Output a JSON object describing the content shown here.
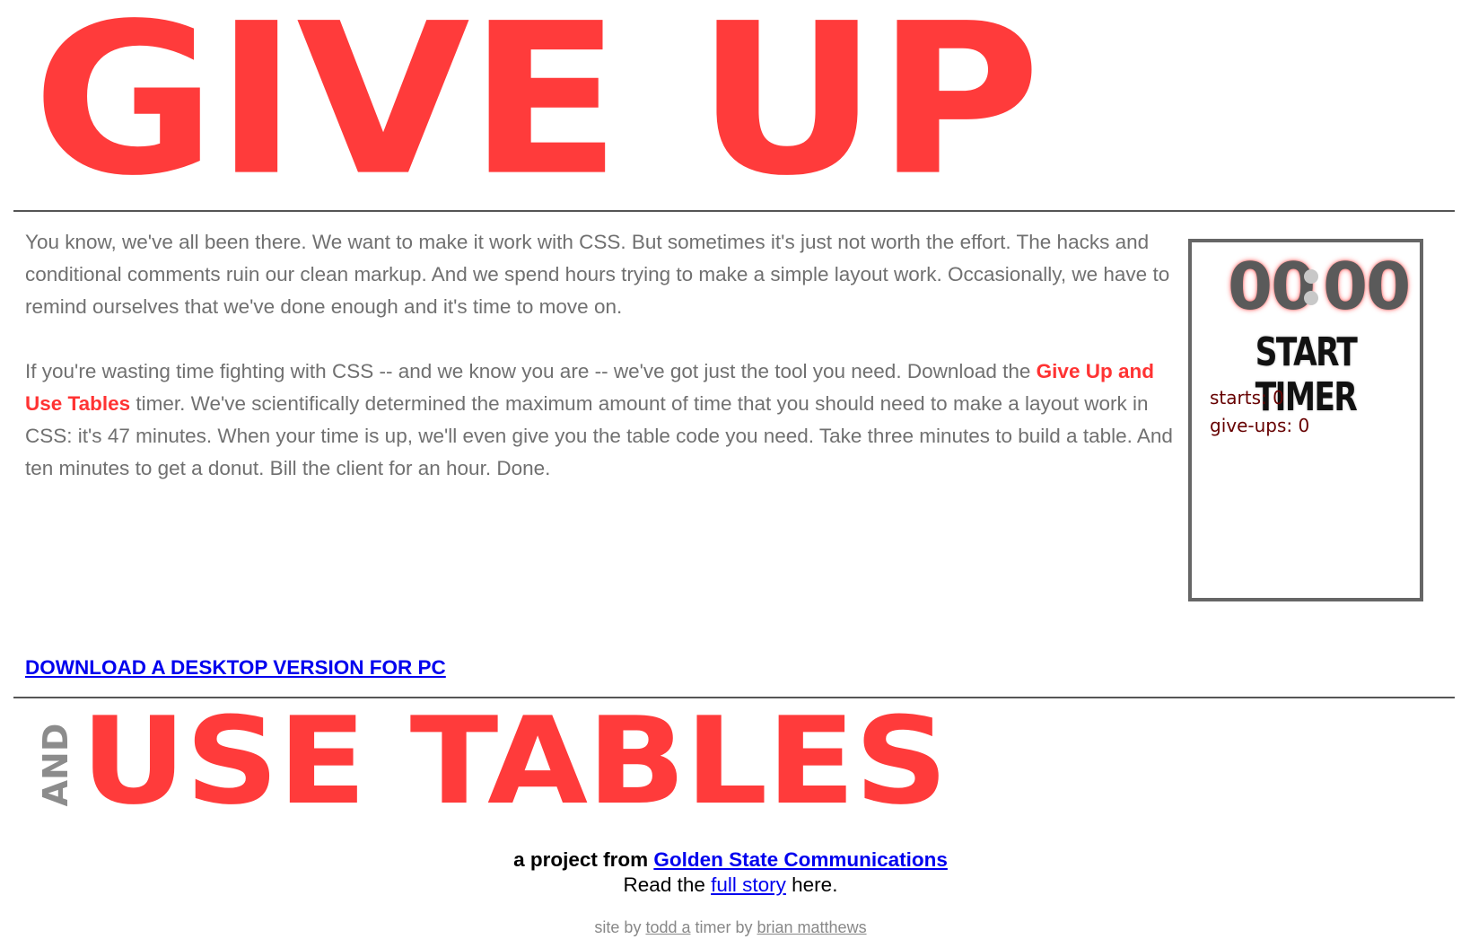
{
  "header": {
    "title": "GIVE UP"
  },
  "intro": {
    "paragraph1": "You know, we've all been there. We want to make it work with CSS. But sometimes it's just not worth the effort. The hacks and conditional comments ruin our clean markup. And we spend hours trying to make a simple layout work. Occasionally, we have to remind ourselves that we've done enough and it's time to move on.",
    "paragraph2_before": "If you're wasting time fighting with CSS -- and we know you are -- we've got just the tool you need. Download the ",
    "paragraph2_highlight": "Give Up and Use Tables",
    "paragraph2_after": " timer. We've scientifically determined the maximum amount of time that you should need to make a layout work in CSS: it's 47 minutes. When your time is up, we'll even give you the table code you need. Take three minutes to build a table. And ten minutes to get a donut. Bill the client for an hour. Done."
  },
  "timer": {
    "minutes": "00",
    "seconds": "00",
    "start_label": "START TIMER",
    "starts_label": "starts:",
    "starts_value": "0",
    "giveups_label": "give-ups:",
    "giveups_value": "0"
  },
  "download": {
    "label": "DOWNLOAD A DESKTOP VERSION FOR PC"
  },
  "footer_logo": {
    "and_text": "AND",
    "title": "USE TABLES"
  },
  "credits": {
    "project_prefix": "a project from ",
    "project_link": "Golden State Communications",
    "read_prefix": "Read the ",
    "read_link": "full story",
    "read_suffix": " here.",
    "site_prefix": "site by ",
    "site_author": "todd a",
    "timer_prefix": " timer by ",
    "timer_author": "brian matthews"
  },
  "colors": {
    "brand_red": "#ff3b3b",
    "body_text": "#707070",
    "link_blue": "#0000ee",
    "stats_text": "#660000",
    "rule": "#555555"
  }
}
